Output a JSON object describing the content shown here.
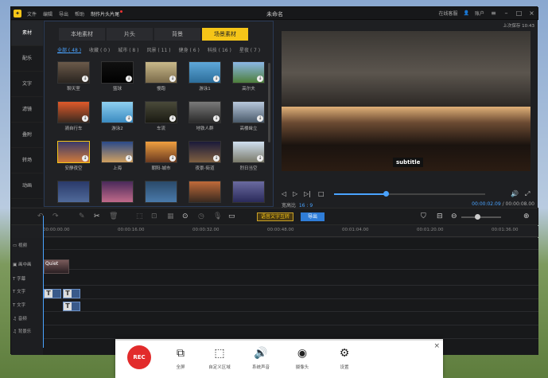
{
  "title": "未命名",
  "menu": [
    "文件",
    "编辑",
    "导出",
    "帮助",
    "制作片头片尾"
  ],
  "top_right": {
    "help": "在线客服",
    "account": "账户"
  },
  "left_tabs": [
    "素材",
    "配乐",
    "文字",
    "滤镜",
    "叠附",
    "转场",
    "动画"
  ],
  "cat_tabs": [
    "本地素材",
    "片头",
    "背景",
    "场景素材"
  ],
  "filters": [
    "全部 ( 48 )",
    "收藏 ( 0 )",
    "城市 ( 8 )",
    "风景 ( 11 )",
    "健身 ( 6 )",
    "科技 ( 16 )",
    "星夜 ( 7 )"
  ],
  "items": [
    {
      "name": "聊天室",
      "c1": "#6b5a4a",
      "c2": "#2a2520"
    },
    {
      "name": "篮球",
      "c1": "#111",
      "c2": "#000"
    },
    {
      "name": "慢跑",
      "c1": "#c9b98a",
      "c2": "#7a6a4a"
    },
    {
      "name": "游泳1",
      "c1": "#5fa8d9",
      "c2": "#2c6d9a"
    },
    {
      "name": "高尔夫",
      "c1": "#8cb8e6",
      "c2": "#4d7e3a"
    },
    {
      "name": "骑自行车",
      "c1": "#e05a2a",
      "c2": "#3a2a20"
    },
    {
      "name": "游泳2",
      "c1": "#8fd0f0",
      "c2": "#3a8ac0"
    },
    {
      "name": "车流",
      "c1": "#4a4a3a",
      "c2": "#1a1a12"
    },
    {
      "name": "地铁人群",
      "c1": "#7a7a7a",
      "c2": "#2a2a2a"
    },
    {
      "name": "高楼耸立",
      "c1": "#b8c8dc",
      "c2": "#4a5a6a"
    },
    {
      "name": "安静夜空",
      "c1": "#3a3a6a",
      "c2": "#d07a3a"
    },
    {
      "name": "上海",
      "c1": "#2a4a8a",
      "c2": "#d0a060"
    },
    {
      "name": "朝阳-城市",
      "c1": "#f0a040",
      "c2": "#6a3a20"
    },
    {
      "name": "夜景-街道",
      "c1": "#1a1a3a",
      "c2": "#806040"
    },
    {
      "name": "烈日当空",
      "c1": "#d0e0f0",
      "c2": "#7a7a6a"
    },
    {
      "name": "",
      "c1": "#2a3a6a",
      "c2": "#506a9a"
    },
    {
      "name": "",
      "c1": "#4a2a5a",
      "c2": "#c06a8a"
    },
    {
      "name": "",
      "c1": "#2a4a6a",
      "c2": "#4a7aaa"
    },
    {
      "name": "",
      "c1": "#c06a3a",
      "c2": "#3a2a20"
    },
    {
      "name": "",
      "c1": "#6a6aa0",
      "c2": "#2a2a5a"
    }
  ],
  "preview": {
    "autosave": "上次保存 10:43",
    "subtitle": "subtitle",
    "aspect_label": "宽高比",
    "aspect_value": "16 : 9",
    "time_current": "00:00:02.09",
    "time_total": " / 00:00:08.00",
    "progress": 0.34
  },
  "toolbar": {
    "voice": "语音文字互转",
    "export": "导出",
    "zoom": 0.4
  },
  "ruler": [
    "00:00:00.00",
    "00:00:16.00",
    "00:00:32.00",
    "00:00:48.00",
    "00:01:04.00",
    "00:01:20.00",
    "00:01:36.00"
  ],
  "track_labels": [
    "视频",
    "画中画",
    "字幕",
    "文字",
    "文字",
    "音频",
    "背景乐"
  ],
  "video_clip": "Quiet",
  "recorder": {
    "rec": "REC",
    "items": [
      {
        "label": "全屏",
        "icon": "⧉"
      },
      {
        "label": "自定义区域",
        "icon": "⬚"
      },
      {
        "label": "系统声音",
        "icon": "🔊"
      },
      {
        "label": "摄像头",
        "icon": "◉"
      },
      {
        "label": "设置",
        "icon": "⚙"
      }
    ],
    "close": "×"
  }
}
